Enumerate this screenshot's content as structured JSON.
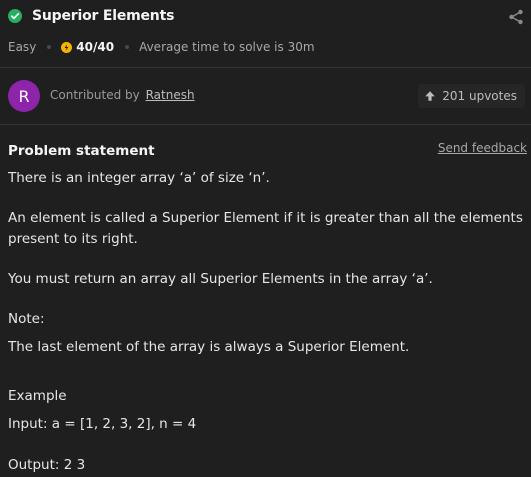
{
  "header": {
    "title": "Superior Elements",
    "difficulty": "Easy",
    "score": "40/40",
    "avg_time": "Average time to solve is 30m"
  },
  "contributor": {
    "avatar_letter": "R",
    "prefix": "Contributed by",
    "name": "Ratnesh",
    "upvotes": "201 upvotes"
  },
  "problem": {
    "heading": "Problem statement",
    "feedback_label": "Send feedback",
    "paragraphs": [
      "There is an integer array ‘a’ of size ‘n’.",
      "An element is called a Superior Element if it is greater than all the elements present to its right.",
      "You must return an array all Superior Elements in the array ‘a’.",
      "Note:",
      "The last element of the array is always a Superior Element.",
      "Example",
      "Input: a = [1, 2, 3, 2], n = 4",
      "Output: 2 3"
    ]
  },
  "colors": {
    "background": "#1f1f1f",
    "solved_check": "#27ae60",
    "avatar": "#8e24aa",
    "coin": "#f5b400"
  },
  "icons": {
    "solved": "check-circle-icon",
    "share": "share-icon",
    "coin": "coin-icon",
    "upvote": "arrow-up-icon"
  }
}
